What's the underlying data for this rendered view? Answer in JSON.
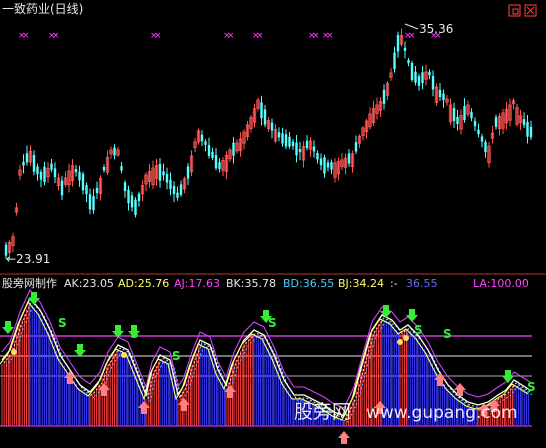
{
  "window": {
    "title": "一致药业(日线)"
  },
  "main_chart": {
    "high_label": "35.36",
    "low_label": "←23.91"
  },
  "indicator": {
    "name": "股旁网制作",
    "values": [
      {
        "key": "AK",
        "text": "AK:23.05",
        "color": "#e8e8e8"
      },
      {
        "key": "AD",
        "text": "AD:25.76",
        "color": "#ffff66"
      },
      {
        "key": "AJ",
        "text": "AJ:17.63",
        "color": "#ff44ff"
      },
      {
        "key": "BK",
        "text": "BK:35.78",
        "color": "#e8e8e8"
      },
      {
        "key": "BD",
        "text": "BD:36.55",
        "color": "#44ccff"
      },
      {
        "key": "BJ",
        "text": "BJ:34.24",
        "color": "#ffff66"
      },
      {
        "key": "sep",
        "text": ":-",
        "color": "#e8e8e8"
      },
      {
        "key": "X",
        "text": "36.55",
        "color": "#6666ff"
      },
      {
        "key": "LA",
        "text": "LA:100.00",
        "color": "#ff44ff"
      }
    ]
  },
  "watermark": {
    "cn": "股旁网",
    "url": "www.gupang.com"
  },
  "colors": {
    "up": "#ff5555",
    "down": "#55ffff",
    "bg": "#000000",
    "magenta": "#ff44ff"
  },
  "chart_data": {
    "type": "candlestick",
    "price_high": 35.36,
    "price_low": 23.91,
    "indicator_levels": {
      "LA": 100.0
    },
    "indicator_values": {
      "AK": 23.05,
      "AD": 25.76,
      "AJ": 17.63,
      "BK": 35.78,
      "BD": 36.55,
      "BJ": 34.24
    }
  }
}
